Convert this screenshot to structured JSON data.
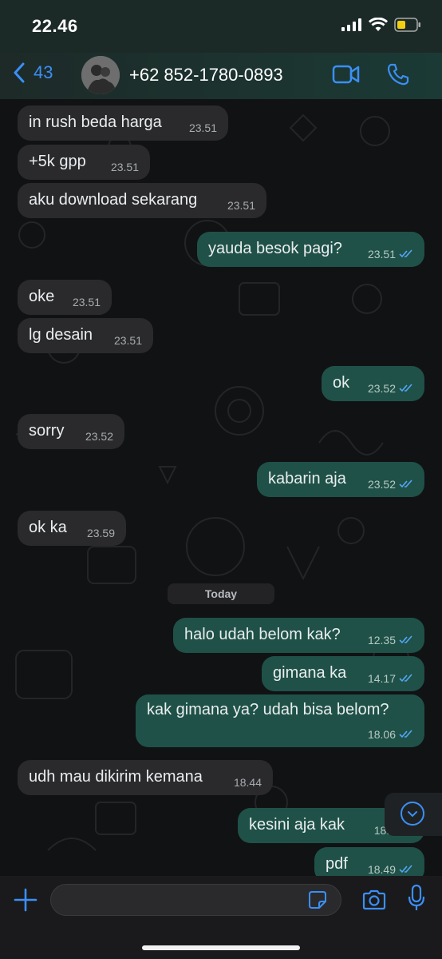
{
  "status_bar": {
    "time": "22.46"
  },
  "header": {
    "back_count": "43",
    "contact_name": "+62 852-1780-0893"
  },
  "messages": [
    {
      "dir": "in",
      "text": "in rush beda harga",
      "time": "23.51"
    },
    {
      "dir": "in",
      "text": "+5k gpp",
      "time": "23.51"
    },
    {
      "dir": "in",
      "text": "aku download sekarang",
      "time": "23.51"
    },
    {
      "dir": "out",
      "text": "yauda besok pagi?",
      "time": "23.51"
    },
    {
      "dir": "in",
      "text": "oke",
      "time": "23.51"
    },
    {
      "dir": "in",
      "text": "lg desain",
      "time": "23.51"
    },
    {
      "dir": "out",
      "text": "ok",
      "time": "23.52"
    },
    {
      "dir": "in",
      "text": "sorry",
      "time": "23.52"
    },
    {
      "dir": "out",
      "text": "kabarin aja",
      "time": "23.52"
    },
    {
      "dir": "in",
      "text": "ok ka",
      "time": "23.59"
    },
    {
      "dir": "out",
      "text": "halo udah belom kak?",
      "time": "12.35"
    },
    {
      "dir": "out",
      "text": "gimana ka",
      "time": "14.17"
    },
    {
      "dir": "out",
      "text": "kak gimana ya? udah bisa belom?",
      "time": "18.06"
    },
    {
      "dir": "in",
      "text": "udh mau dikirim kemana",
      "time": "18.44"
    },
    {
      "dir": "out",
      "text": "kesini aja kak",
      "time": "18.4"
    },
    {
      "dir": "out",
      "text": "pdf",
      "time": "18.49"
    }
  ],
  "date_separator": "Today",
  "colors": {
    "accent": "#3b8ff6",
    "outgoing": "#1f5148",
    "incoming": "#2a2a2c"
  },
  "icons": [
    "back-chevron-icon",
    "video-call-icon",
    "phone-icon",
    "plus-icon",
    "sticker-icon",
    "camera-icon",
    "mic-icon",
    "scroll-down-icon"
  ]
}
